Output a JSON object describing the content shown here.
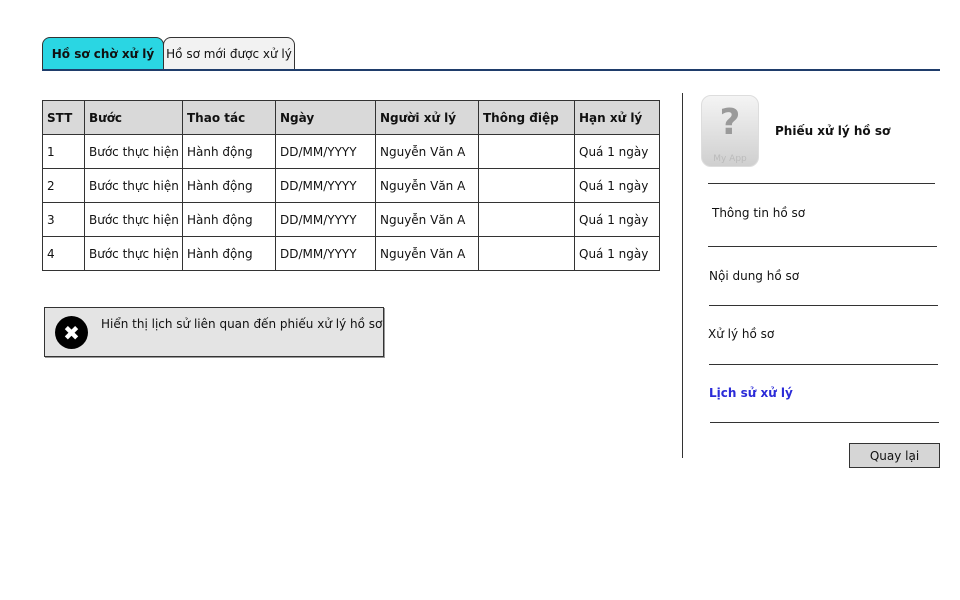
{
  "tabs": {
    "pending_label": "Hồ sơ chờ xử lý",
    "new_label": "Hồ sơ mới được xử lý"
  },
  "table": {
    "headers": [
      "STT",
      "Bước",
      "Thao tác",
      "Ngày",
      "Người xử lý",
      "Thông điệp",
      "Hạn xử lý"
    ],
    "rows": [
      [
        "1",
        "Bước thực hiện",
        "Hành động",
        "DD/MM/YYYY",
        "Nguyễn Văn A",
        "",
        "Quá 1 ngày"
      ],
      [
        "2",
        "Bước thực hiện",
        "Hành động",
        "DD/MM/YYYY",
        "Nguyễn Văn A",
        "",
        "Quá 1 ngày"
      ],
      [
        "3",
        "Bước thực hiện",
        "Hành động",
        "DD/MM/YYYY",
        "Nguyễn Văn A",
        "",
        "Quá 1 ngày"
      ],
      [
        "4",
        "Bước thực hiện",
        "Hành động",
        "DD/MM/YYYY",
        "Nguyễn Văn A",
        "",
        "Quá 1 ngày"
      ]
    ]
  },
  "alert": {
    "icon": "close-icon",
    "message": "Hiển thị lịch sử liên quan đến phiếu xử lý hồ sơ"
  },
  "panel": {
    "app_icon_glyph": "?",
    "app_icon_caption": "My App",
    "title": "Phiếu xử lý hồ sơ",
    "menu": [
      {
        "label": "Thông tin hồ sơ"
      },
      {
        "label": "Nội dung hồ sơ"
      },
      {
        "label": "Xử lý hồ sơ"
      },
      {
        "label": "Lịch sử xử lý"
      }
    ],
    "back_label": "Quay lại"
  },
  "colors": {
    "active_tab": "#2ad6e3",
    "tab_underline": "#1f3d6b",
    "active_menu": "#2b2bd8"
  }
}
